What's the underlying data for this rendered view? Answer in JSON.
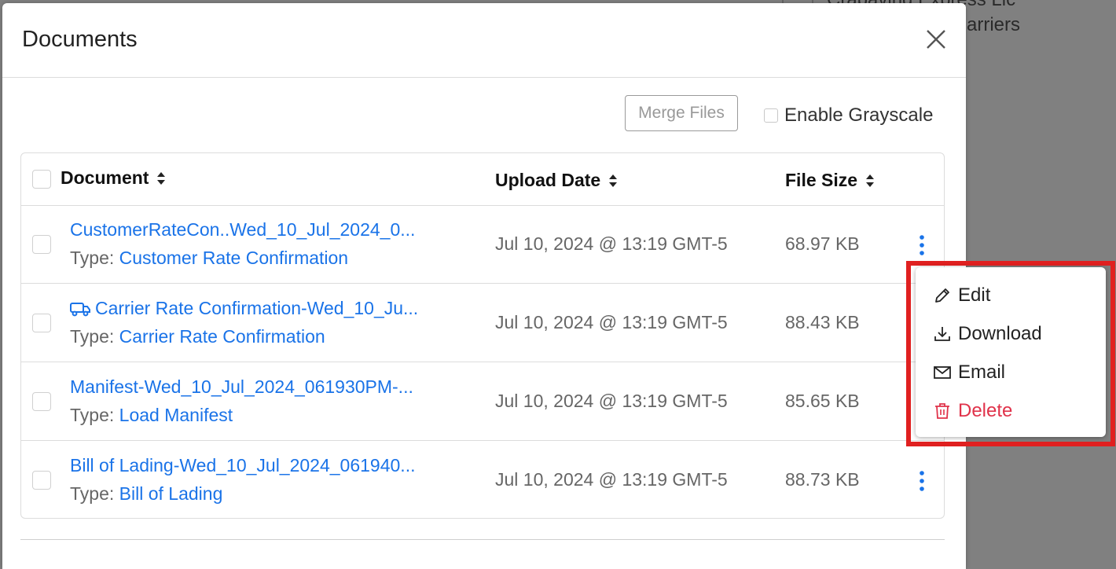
{
  "background": {
    "line1": "Crabaving Express Lic",
    "line2": "arriers"
  },
  "modal": {
    "title": "Documents",
    "merge_label": "Merge Files",
    "grayscale_label": "Enable Grayscale"
  },
  "table": {
    "headers": {
      "document": "Document",
      "upload_date": "Upload Date",
      "file_size": "File Size"
    },
    "type_prefix": "Type:",
    "rows": [
      {
        "name": "CustomerRateCon..Wed_10_Jul_2024_0...",
        "type": "Customer Rate Confirmation",
        "date": "Jul 10, 2024 @ 13:19 GMT-5",
        "size": "68.97 KB",
        "icon": "truck-icon",
        "has_icon": false
      },
      {
        "name": "Carrier Rate Confirmation-Wed_10_Ju...",
        "type": "Carrier Rate Confirmation",
        "date": "Jul 10, 2024 @ 13:19 GMT-5",
        "size": "88.43 KB",
        "icon": "truck-icon",
        "has_icon": true
      },
      {
        "name": "Manifest-Wed_10_Jul_2024_061930PM-...",
        "type": "Load Manifest",
        "date": "Jul 10, 2024 @ 13:19 GMT-5",
        "size": "85.65 KB",
        "icon": "",
        "has_icon": false
      },
      {
        "name": "Bill of Lading-Wed_10_Jul_2024_061940...",
        "type": "Bill of Lading",
        "date": "Jul 10, 2024 @ 13:19 GMT-5",
        "size": "88.73 KB",
        "icon": "",
        "has_icon": false
      }
    ]
  },
  "menu": {
    "edit": "Edit",
    "download": "Download",
    "email": "Email",
    "delete": "Delete"
  },
  "colors": {
    "link": "#1a73e8",
    "danger": "#e0324a",
    "highlight": "#e02020",
    "overlay": "#808080"
  }
}
